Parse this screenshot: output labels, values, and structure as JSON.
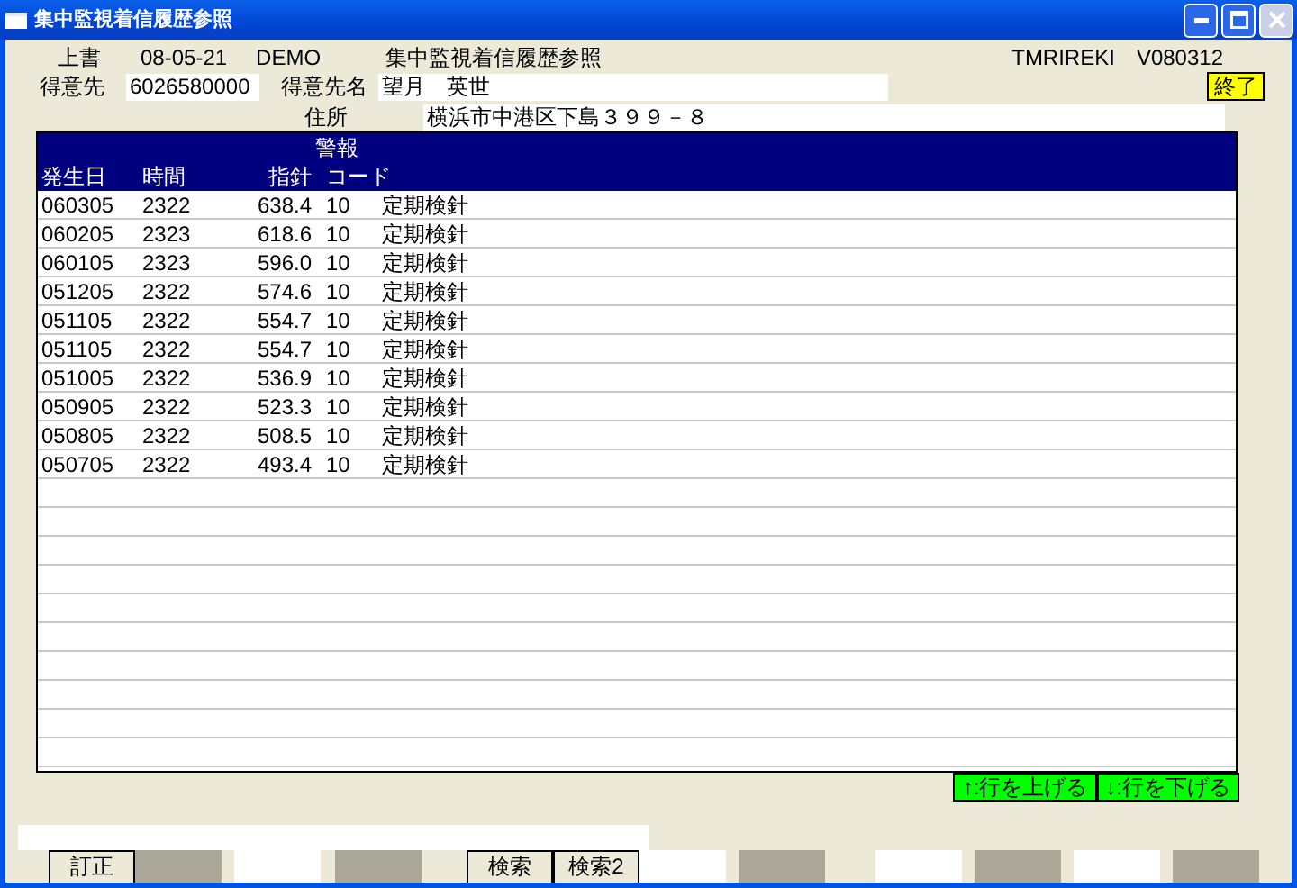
{
  "window": {
    "title": "集中監視着信履歴参照",
    "controls": [
      {
        "kind": "minimize",
        "disabled": false
      },
      {
        "kind": "maximize",
        "disabled": false
      },
      {
        "kind": "close",
        "disabled": true
      }
    ]
  },
  "header": {
    "mode": "上書",
    "date": "08-05-21",
    "user": "DEMO",
    "screen_title": "集中監視着信履歴参照",
    "program_id": "TMRIREKI",
    "version": "V080312"
  },
  "customer": {
    "code_label": "得意先",
    "code": "6026580000",
    "name_label": "得意先名",
    "name": "望月　英世",
    "address_label": "住所",
    "address": "横浜市中港区下島３９９－８"
  },
  "exit_button": "終了",
  "table": {
    "columns": [
      {
        "label": "発生日"
      },
      {
        "label": "時間"
      },
      {
        "label": "指針"
      },
      {
        "top": "警報",
        "label": "コード"
      }
    ],
    "rows": [
      [
        "060305",
        "2322",
        "638.4",
        "10",
        "定期検針"
      ],
      [
        "060205",
        "2323",
        "618.6",
        "10",
        "定期検針"
      ],
      [
        "060105",
        "2323",
        "596.0",
        "10",
        "定期検針"
      ],
      [
        "051205",
        "2322",
        "574.6",
        "10",
        "定期検針"
      ],
      [
        "051105",
        "2322",
        "554.7",
        "10",
        "定期検針"
      ],
      [
        "051105",
        "2322",
        "554.7",
        "10",
        "定期検針"
      ],
      [
        "051005",
        "2322",
        "536.9",
        "10",
        "定期検針"
      ],
      [
        "050905",
        "2322",
        "523.3",
        "10",
        "定期検針"
      ],
      [
        "050805",
        "2322",
        "508.5",
        "10",
        "定期検針"
      ],
      [
        "050705",
        "2322",
        "493.4",
        "10",
        "定期検針"
      ]
    ]
  },
  "scroll_buttons": [
    "↑:行を上げる",
    "↓:行を下げる"
  ],
  "function_keys": [
    {
      "kind": "button",
      "label": "訂正"
    },
    {
      "kind": "off"
    },
    {
      "kind": "blank"
    },
    {
      "kind": "off"
    },
    {
      "kind": "button",
      "label": "検索"
    },
    {
      "kind": "button",
      "label": "検索2"
    },
    {
      "kind": "blank"
    },
    {
      "kind": "off"
    },
    {
      "kind": "blank"
    },
    {
      "kind": "off"
    },
    {
      "kind": "blank"
    },
    {
      "kind": "off"
    }
  ]
}
